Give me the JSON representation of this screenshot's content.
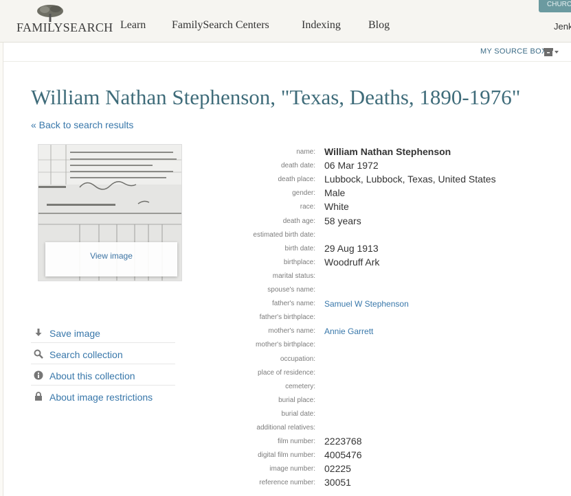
{
  "header": {
    "logo_text": "FamilySearch",
    "nav": [
      "Learn",
      "FamilySearch Centers",
      "Indexing",
      "Blog"
    ],
    "church_tab": "CHURC",
    "user": "Jenk"
  },
  "source_box": {
    "label": "MY SOURCE BOX"
  },
  "record": {
    "title": "William Nathan Stephenson, \"Texas, Deaths, 1890-1976\"",
    "back_link": "« Back to search results"
  },
  "image_panel": {
    "view_image": "View image"
  },
  "actions": [
    {
      "label": "Save image",
      "icon": "download-icon"
    },
    {
      "label": "Search collection",
      "icon": "search-icon"
    },
    {
      "label": "About this collection",
      "icon": "info-icon"
    },
    {
      "label": "About image restrictions",
      "icon": "lock-icon"
    }
  ],
  "fields": [
    {
      "label": "name:",
      "value": "William Nathan Stephenson",
      "style": "bold"
    },
    {
      "label": "death date:",
      "value": "06 Mar 1972"
    },
    {
      "label": "death place:",
      "value": "Lubbock, Lubbock, Texas, United States"
    },
    {
      "label": "gender:",
      "value": "Male"
    },
    {
      "label": "race:",
      "value": "White"
    },
    {
      "label": "death age:",
      "value": "58 years"
    },
    {
      "label": "estimated birth date:",
      "value": ""
    },
    {
      "label": "birth date:",
      "value": "29 Aug 1913"
    },
    {
      "label": "birthplace:",
      "value": "Woodruff Ark"
    },
    {
      "label": "marital status:",
      "value": ""
    },
    {
      "label": "spouse's name:",
      "value": ""
    },
    {
      "label": "father's name:",
      "value": "Samuel W Stephenson",
      "style": "link"
    },
    {
      "label": "father's birthplace:",
      "value": ""
    },
    {
      "label": "mother's name:",
      "value": "Annie Garrett",
      "style": "link"
    },
    {
      "label": "mother's birthplace:",
      "value": ""
    },
    {
      "label": "occupation:",
      "value": ""
    },
    {
      "label": "place of residence:",
      "value": ""
    },
    {
      "label": "cemetery:",
      "value": ""
    },
    {
      "label": "burial place:",
      "value": ""
    },
    {
      "label": "burial date:",
      "value": ""
    },
    {
      "label": "additional relatives:",
      "value": ""
    },
    {
      "label": "film number:",
      "value": "2223768"
    },
    {
      "label": "digital film number:",
      "value": "4005476"
    },
    {
      "label": "image number:",
      "value": "02225"
    },
    {
      "label": "reference number:",
      "value": "30051"
    }
  ],
  "colors": {
    "title": "#3f6c7a",
    "link": "#3877aa",
    "label": "#7c7c7c",
    "church_tab": "#6b9aa0"
  }
}
